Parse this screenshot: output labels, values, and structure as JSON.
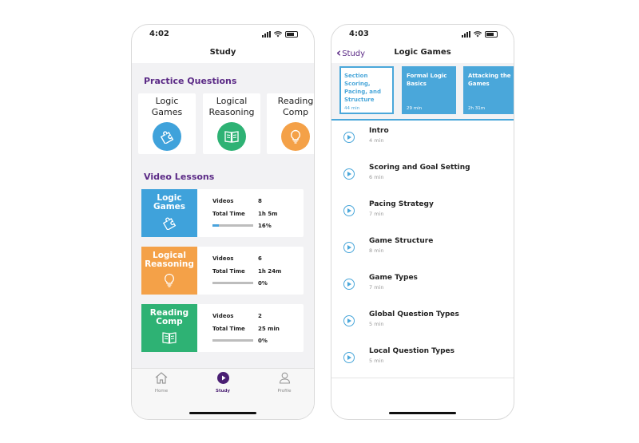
{
  "phone1": {
    "status_time": "4:02",
    "nav_title": "Study",
    "practice_title": "Practice Questions",
    "practice_items": [
      {
        "label": "Logic\nGames",
        "icon": "puzzle-icon",
        "color": "#3fa2db"
      },
      {
        "label": "Logical\nReasoning",
        "icon": "book-icon",
        "color": "#2eb274"
      },
      {
        "label": "Reading\nComp",
        "icon": "lightbulb-icon",
        "color": "#f4a148"
      }
    ],
    "video_title": "Video Lessons",
    "video_lessons": [
      {
        "title": "Logic\nGames",
        "icon": "puzzle-icon",
        "color": "#3fa2db",
        "videos_label": "Videos",
        "videos": "8",
        "time_label": "Total Time",
        "time": "1h 5m",
        "progress_label": "16%",
        "progress": 0.16
      },
      {
        "title": "Logical\nReasoning",
        "icon": "lightbulb-icon",
        "color": "#f4a148",
        "videos_label": "Videos",
        "videos": "6",
        "time_label": "Total Time",
        "time": "1h 24m",
        "progress_label": "0%",
        "progress": 0
      },
      {
        "title": "Reading\nComp",
        "icon": "book-icon",
        "color": "#2eb274",
        "videos_label": "Videos",
        "videos": "2",
        "time_label": "Total Time",
        "time": "25 min",
        "progress_label": "0%",
        "progress": 0
      }
    ],
    "tabs": [
      {
        "label": "Home",
        "icon": "home-icon",
        "active": false
      },
      {
        "label": "Study",
        "icon": "play-circle-icon",
        "active": true
      },
      {
        "label": "Profile",
        "icon": "profile-icon",
        "active": false
      }
    ],
    "accent_color": "#5b2a86"
  },
  "phone2": {
    "status_time": "4:03",
    "back_label": "Study",
    "nav_title": "Logic Games",
    "cards": [
      {
        "title": "Section Scoring, Pacing, and Structure",
        "duration": "44 min",
        "selected": true
      },
      {
        "title": "Formal Logic Basics",
        "duration": "29 min",
        "selected": false
      },
      {
        "title": "Attacking the Games",
        "duration": "2h 31m",
        "selected": false
      }
    ],
    "lessons": [
      {
        "title": "Intro",
        "duration": "4 min"
      },
      {
        "title": "Scoring and Goal Setting",
        "duration": "6 min"
      },
      {
        "title": "Pacing Strategy",
        "duration": "7 min"
      },
      {
        "title": "Game Structure",
        "duration": "8 min"
      },
      {
        "title": "Game Types",
        "duration": "7 min"
      },
      {
        "title": "Global Question Types",
        "duration": "5 min"
      },
      {
        "title": "Local Question Types",
        "duration": "5 min"
      }
    ]
  }
}
